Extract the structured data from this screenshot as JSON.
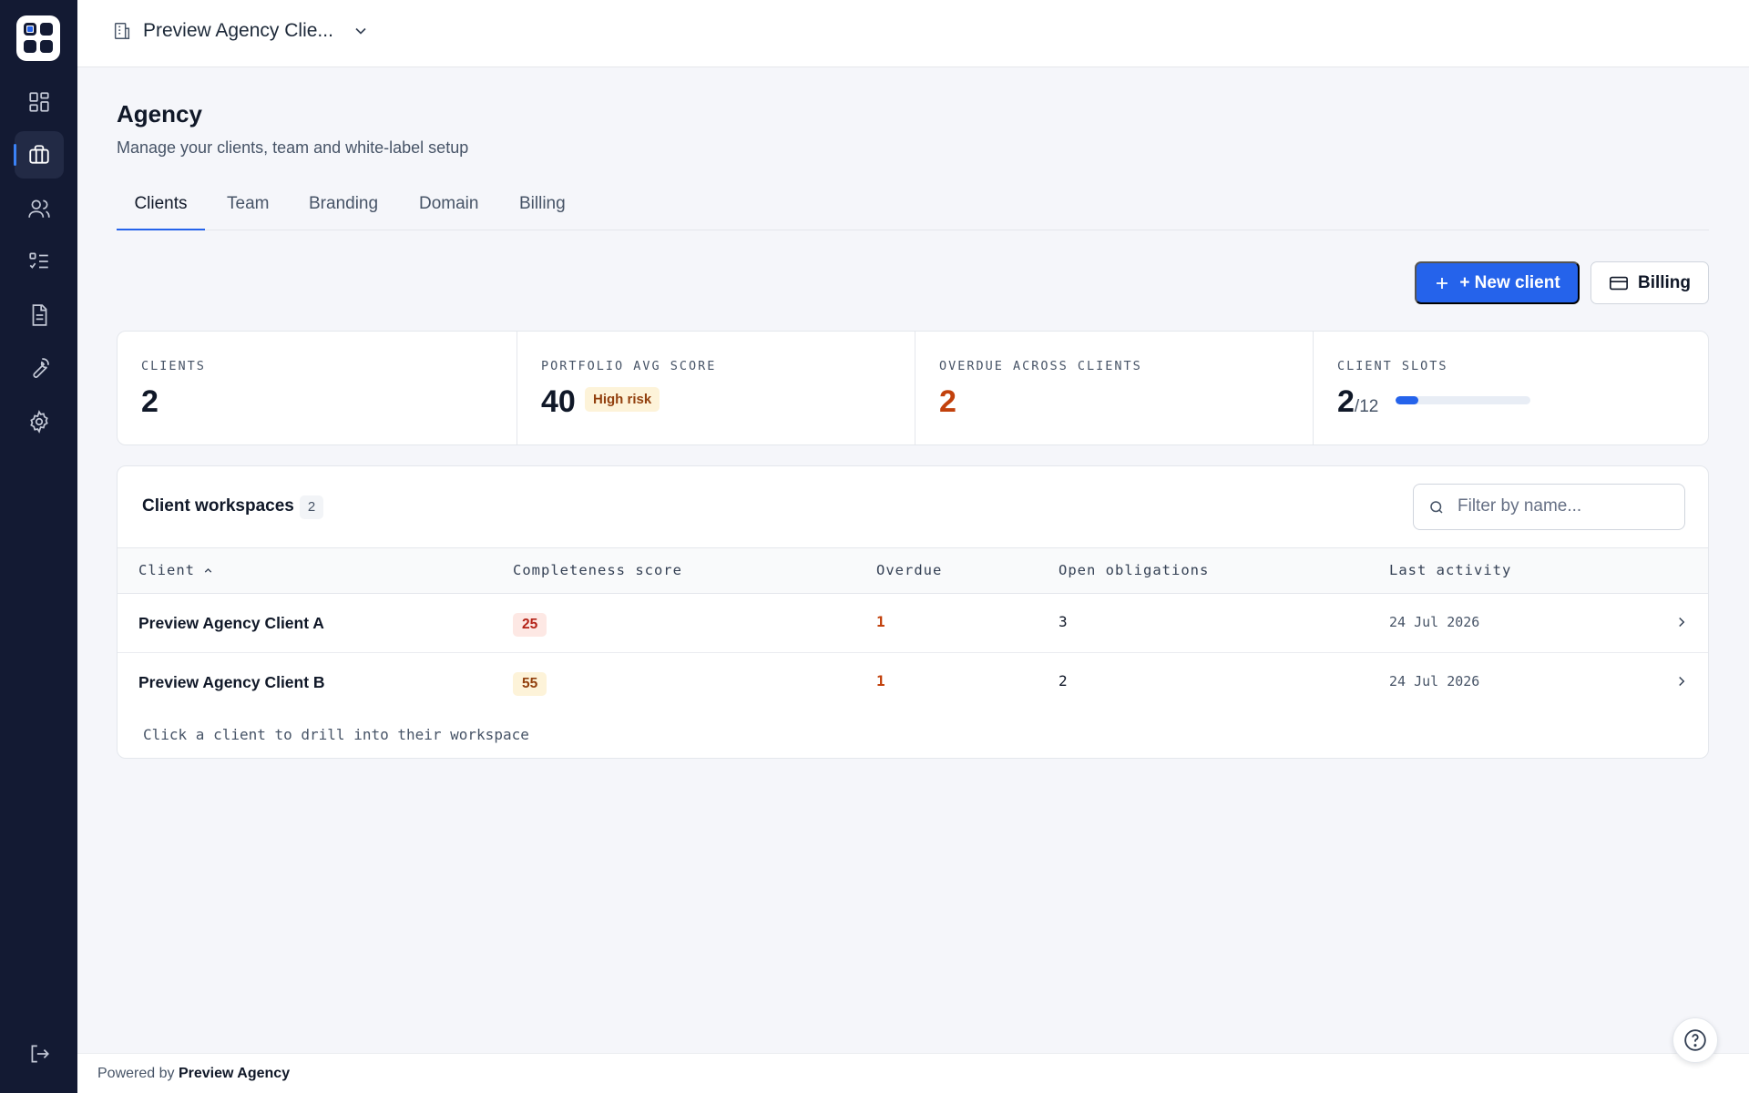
{
  "header": {
    "workspace_name": "Preview Agency Clie...",
    "workspace_icon": "building-icon",
    "switch_icon": "chevron-down-icon"
  },
  "sidebar": {
    "items": [
      {
        "icon": "dashboard-grid-icon",
        "active": false
      },
      {
        "icon": "briefcase-icon",
        "active": true
      },
      {
        "icon": "users-icon",
        "active": false
      },
      {
        "icon": "checklist-icon",
        "active": false
      },
      {
        "icon": "document-icon",
        "active": false
      },
      {
        "icon": "wrench-icon",
        "active": false
      },
      {
        "icon": "gear-icon",
        "active": false
      }
    ],
    "logout_icon": "logout-icon"
  },
  "page": {
    "title": "Agency",
    "subtitle": "Manage your clients, team and white-label setup"
  },
  "tabs": [
    "Clients",
    "Team",
    "Branding",
    "Domain",
    "Billing"
  ],
  "active_tab": "Clients",
  "actions": {
    "new_client_label": "+ New client",
    "billing_label": "Billing"
  },
  "stats": {
    "clients": {
      "label": "CLIENTS",
      "value": "2"
    },
    "portfolio": {
      "label": "PORTFOLIO AVG SCORE",
      "value": "40",
      "badge": "High risk"
    },
    "overdue": {
      "label": "OVERDUE ACROSS CLIENTS",
      "value": "2"
    },
    "slots": {
      "label": "CLIENT SLOTS",
      "used": "2",
      "total": "/12",
      "fill_fraction": 0.17
    }
  },
  "workspaces": {
    "title": "Client workspaces",
    "count": "2",
    "filter_placeholder": "Filter by name...",
    "columns": [
      "Client",
      "Completeness score",
      "Overdue",
      "Open obligations",
      "Last activity"
    ],
    "rows": [
      {
        "client": "Preview Agency Client A",
        "score": "25",
        "overdue": "1",
        "open": "3",
        "activity": "24 Jul 2026"
      },
      {
        "client": "Preview Agency Client B",
        "score": "55",
        "overdue": "1",
        "open": "2",
        "activity": "24 Jul 2026"
      }
    ],
    "hint": "Click a client to drill into their workspace"
  },
  "footer": {
    "prefix": "Powered by",
    "brand": "Preview Agency"
  },
  "colors": {
    "sidebar": "#131a33",
    "accent": "#2563eb",
    "danger": "#c2410c",
    "warning_bg": "#fdf3d9"
  }
}
